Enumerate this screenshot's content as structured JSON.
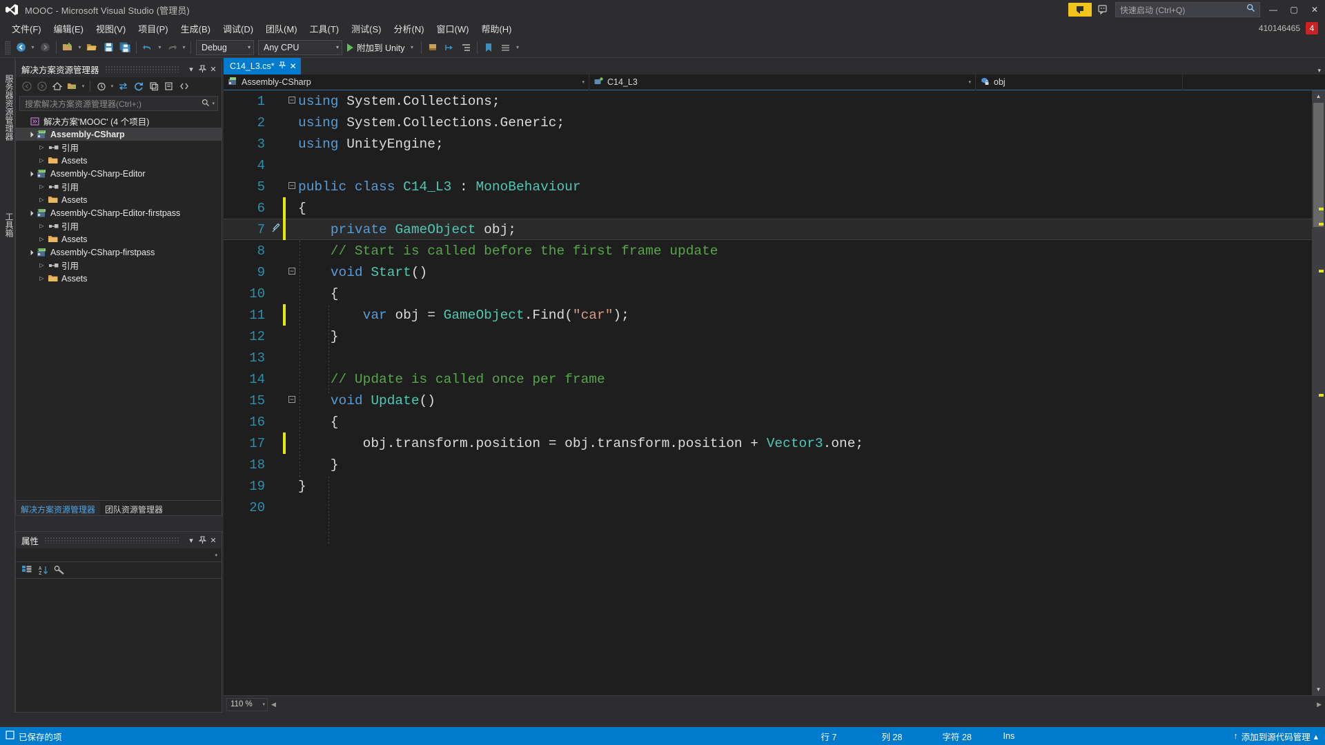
{
  "titlebar": {
    "title": "MOOC - Microsoft Visual Studio (管理员)",
    "logo_icon": "visual-studio-logo",
    "notification_icon": "notification-flag-icon",
    "feedback_icon": "feedback-smiley-icon",
    "quick_launch_placeholder": "快速启动 (Ctrl+Q)",
    "quick_launch_value": "",
    "search_icon": "search-icon",
    "minimize": "—",
    "maximize": "▢",
    "close": "✕"
  },
  "menubar": {
    "items": [
      "文件(F)",
      "编辑(E)",
      "视图(V)",
      "项目(P)",
      "生成(B)",
      "调试(D)",
      "团队(M)",
      "工具(T)",
      "测试(S)",
      "分析(N)",
      "窗口(W)",
      "帮助(H)"
    ],
    "account_number": "410146465",
    "account_badge": "4"
  },
  "toolbar": {
    "back_icon": "navigate-back-icon",
    "forward_icon": "navigate-forward-icon",
    "new_project_icon": "new-project-icon",
    "open_file_icon": "open-file-icon",
    "save_icon": "save-icon",
    "save_all_icon": "save-all-icon",
    "undo_icon": "undo-icon",
    "redo_icon": "redo-icon",
    "config_value": "Debug",
    "platform_value": "Any CPU",
    "run_label": "附加到 Unity",
    "run_icon": "play-icon",
    "extra_icons": [
      "highlight-icon",
      "step-icon",
      "indent-icon",
      "bookmark-icon",
      "list-icon"
    ]
  },
  "vdock": {
    "labels": [
      "服务器资源管理器",
      "工具箱"
    ]
  },
  "solution_explorer": {
    "title": "解决方案资源管理器",
    "window_caret": "▾",
    "pin_icon": "pin-icon",
    "close_icon": "close-icon",
    "toolbar_icons": [
      "back-icon",
      "forward-icon",
      "home-icon",
      "show-all-files-icon",
      "pending-changes-icon",
      "sync-with-active-document-icon",
      "refresh-icon",
      "collapse-all-icon",
      "properties-icon",
      "view-code-icon"
    ],
    "search_placeholder": "搜索解决方案资源管理器(Ctrl+;)",
    "tree": [
      {
        "label": "解决方案'MOOC' (4 个项目)",
        "icon": "solution-icon",
        "level": 0,
        "twisty": "",
        "bold": false,
        "selected": false
      },
      {
        "label": "Assembly-CSharp",
        "icon": "csharp-project-icon",
        "level": 1,
        "twisty": "▴",
        "bold": true,
        "selected": true
      },
      {
        "label": "引用",
        "icon": "references-icon",
        "level": 2,
        "twisty": "▸",
        "bold": false,
        "selected": false
      },
      {
        "label": "Assets",
        "icon": "folder-icon",
        "level": 2,
        "twisty": "▸",
        "bold": false,
        "selected": false
      },
      {
        "label": "Assembly-CSharp-Editor",
        "icon": "csharp-project-icon",
        "level": 1,
        "twisty": "▴",
        "bold": false,
        "selected": false
      },
      {
        "label": "引用",
        "icon": "references-icon",
        "level": 2,
        "twisty": "▸",
        "bold": false,
        "selected": false
      },
      {
        "label": "Assets",
        "icon": "folder-icon",
        "level": 2,
        "twisty": "▸",
        "bold": false,
        "selected": false
      },
      {
        "label": "Assembly-CSharp-Editor-firstpass",
        "icon": "csharp-project-icon",
        "level": 1,
        "twisty": "▴",
        "bold": false,
        "selected": false
      },
      {
        "label": "引用",
        "icon": "references-icon",
        "level": 2,
        "twisty": "▸",
        "bold": false,
        "selected": false
      },
      {
        "label": "Assets",
        "icon": "folder-icon",
        "level": 2,
        "twisty": "▸",
        "bold": false,
        "selected": false
      },
      {
        "label": "Assembly-CSharp-firstpass",
        "icon": "csharp-project-icon",
        "level": 1,
        "twisty": "▴",
        "bold": false,
        "selected": false
      },
      {
        "label": "引用",
        "icon": "references-icon",
        "level": 2,
        "twisty": "▸",
        "bold": false,
        "selected": false
      },
      {
        "label": "Assets",
        "icon": "folder-icon",
        "level": 2,
        "twisty": "▸",
        "bold": false,
        "selected": false
      }
    ],
    "tabs": [
      {
        "label": "解决方案资源管理器",
        "active": true
      },
      {
        "label": "团队资源管理器",
        "active": false
      }
    ]
  },
  "properties": {
    "title": "属性",
    "window_caret": "▾",
    "pin_icon": "pin-icon",
    "close_icon": "close-icon",
    "combo_caret": "▾",
    "toolbar_icons": [
      "categorized-icon",
      "alphabetical-icon",
      "property-pages-icon"
    ]
  },
  "editor": {
    "tab": {
      "label": "C14_L3.cs*",
      "pin_icon": "pin-icon",
      "close_icon": "close-icon"
    },
    "tabstrip_overflow_icon": "chevron-down-icon",
    "navbar": {
      "project": "Assembly-CSharp",
      "project_icon": "csharp-project-icon",
      "type": "C14_L3",
      "type_icon": "class-icon",
      "member": "obj",
      "member_icon": "field-private-icon",
      "caret": "▾"
    },
    "zoom": "110 %",
    "zoom_caret": "▾",
    "lines": [
      {
        "n": "1",
        "fold": "−",
        "change": "",
        "glyph": "",
        "tokens": [
          {
            "t": "using ",
            "c": "kw"
          },
          {
            "t": "System.Collections;",
            "c": "pl"
          }
        ]
      },
      {
        "n": "2",
        "fold": "",
        "change": "",
        "glyph": "",
        "tokens": [
          {
            "t": "using ",
            "c": "kw"
          },
          {
            "t": "System.Collections.Generic;",
            "c": "pl"
          }
        ]
      },
      {
        "n": "3",
        "fold": "",
        "change": "",
        "glyph": "",
        "tokens": [
          {
            "t": "using ",
            "c": "kw"
          },
          {
            "t": "UnityEngine;",
            "c": "pl"
          }
        ]
      },
      {
        "n": "4",
        "fold": "",
        "change": "",
        "glyph": "",
        "tokens": []
      },
      {
        "n": "5",
        "fold": "−",
        "change": "",
        "glyph": "",
        "tokens": [
          {
            "t": "public class ",
            "c": "kw"
          },
          {
            "t": "C14_L3",
            "c": "type"
          },
          {
            "t": " : ",
            "c": "pl"
          },
          {
            "t": "MonoBehaviour",
            "c": "type"
          }
        ]
      },
      {
        "n": "6",
        "fold": "",
        "change": "yellow",
        "glyph": "",
        "tokens": [
          {
            "t": "{",
            "c": "pl"
          }
        ]
      },
      {
        "n": "7",
        "fold": "",
        "change": "yellow",
        "glyph": "quick-actions-icon",
        "tokens": [
          {
            "t": "    ",
            "c": "pl"
          },
          {
            "t": "private ",
            "c": "kw"
          },
          {
            "t": "GameObject",
            "c": "type"
          },
          {
            "t": " obj;",
            "c": "pl"
          }
        ]
      },
      {
        "n": "8",
        "fold": "",
        "change": "",
        "glyph": "",
        "tokens": [
          {
            "t": "    // Start is called before the first frame update",
            "c": "cmt"
          }
        ]
      },
      {
        "n": "9",
        "fold": "−",
        "change": "",
        "glyph": "",
        "tokens": [
          {
            "t": "    ",
            "c": "pl"
          },
          {
            "t": "void ",
            "c": "kw"
          },
          {
            "t": "Start",
            "c": "type"
          },
          {
            "t": "()",
            "c": "pl"
          }
        ]
      },
      {
        "n": "10",
        "fold": "",
        "change": "",
        "glyph": "",
        "tokens": [
          {
            "t": "    {",
            "c": "pl"
          }
        ]
      },
      {
        "n": "11",
        "fold": "",
        "change": "yellow",
        "glyph": "",
        "tokens": [
          {
            "t": "        ",
            "c": "pl"
          },
          {
            "t": "var ",
            "c": "kw"
          },
          {
            "t": "obj = ",
            "c": "pl"
          },
          {
            "t": "GameObject",
            "c": "type"
          },
          {
            "t": ".Find(",
            "c": "pl"
          },
          {
            "t": "\"car\"",
            "c": "str"
          },
          {
            "t": ");",
            "c": "pl"
          }
        ]
      },
      {
        "n": "12",
        "fold": "",
        "change": "",
        "glyph": "",
        "tokens": [
          {
            "t": "    }",
            "c": "pl"
          }
        ]
      },
      {
        "n": "13",
        "fold": "",
        "change": "",
        "glyph": "",
        "tokens": []
      },
      {
        "n": "14",
        "fold": "",
        "change": "",
        "glyph": "",
        "tokens": [
          {
            "t": "    // Update is called once per frame",
            "c": "cmt"
          }
        ]
      },
      {
        "n": "15",
        "fold": "−",
        "change": "",
        "glyph": "",
        "tokens": [
          {
            "t": "    ",
            "c": "pl"
          },
          {
            "t": "void ",
            "c": "kw"
          },
          {
            "t": "Update",
            "c": "type"
          },
          {
            "t": "()",
            "c": "pl"
          }
        ]
      },
      {
        "n": "16",
        "fold": "",
        "change": "",
        "glyph": "",
        "tokens": [
          {
            "t": "    {",
            "c": "pl"
          }
        ]
      },
      {
        "n": "17",
        "fold": "",
        "change": "yellow",
        "glyph": "",
        "tokens": [
          {
            "t": "        obj.transform.position = obj.transform.position + ",
            "c": "pl"
          },
          {
            "t": "Vector3",
            "c": "type"
          },
          {
            "t": ".one;",
            "c": "pl"
          }
        ]
      },
      {
        "n": "18",
        "fold": "",
        "change": "",
        "glyph": "",
        "tokens": [
          {
            "t": "    }",
            "c": "pl"
          }
        ]
      },
      {
        "n": "19",
        "fold": "",
        "change": "",
        "glyph": "",
        "tokens": [
          {
            "t": "}",
            "c": "pl"
          }
        ]
      },
      {
        "n": "20",
        "fold": "",
        "change": "",
        "glyph": "",
        "tokens": []
      }
    ]
  },
  "statusbar": {
    "saved_icon": "saved-item-icon",
    "status": "已保存的项",
    "line_label": "行 7",
    "column_label": "列 28",
    "char_label": "字符 28",
    "insert_mode": "Ins",
    "source_control": "添加到源代码管理",
    "source_control_icon": "upload-icon",
    "source_control_caret": "▴"
  },
  "colors": {
    "accent": "#007acc",
    "titlebar_bg": "#2d2d30",
    "editor_bg": "#1e1e1e",
    "panel_bg": "#252526",
    "keyword": "#569cd6",
    "type": "#4ec9b0",
    "comment": "#57a64a",
    "string": "#d69d85",
    "linenumber": "#2b91af",
    "change_bar": "#e5e510"
  }
}
